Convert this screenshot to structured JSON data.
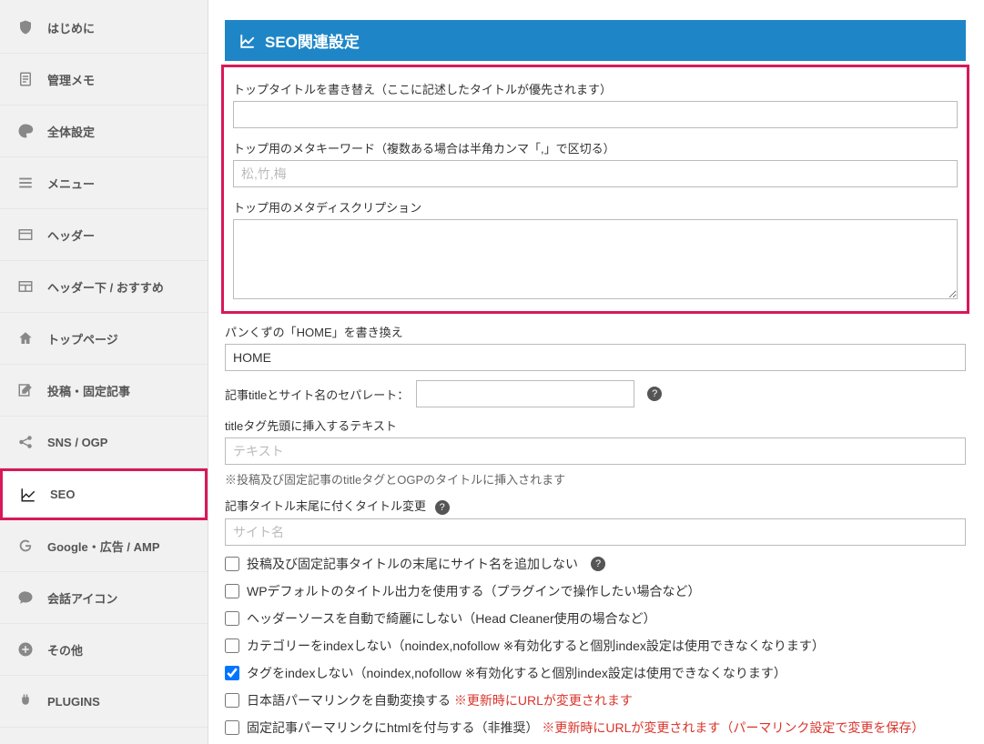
{
  "sidebar": {
    "items": [
      {
        "label": "はじめに"
      },
      {
        "label": "管理メモ"
      },
      {
        "label": "全体設定"
      },
      {
        "label": "メニュー"
      },
      {
        "label": "ヘッダー"
      },
      {
        "label": "ヘッダー下 / おすすめ"
      },
      {
        "label": "トップページ"
      },
      {
        "label": "投稿・固定記事"
      },
      {
        "label": "SNS / OGP"
      },
      {
        "label": "SEO"
      },
      {
        "label": "Google・広告 / AMP"
      },
      {
        "label": "会話アイコン"
      },
      {
        "label": "その他"
      },
      {
        "label": "PLUGINS"
      }
    ]
  },
  "panel": {
    "title": "SEO関連設定"
  },
  "fields": {
    "top_title_label": "トップタイトルを書き替え（ここに記述したタイトルが優先されます）",
    "top_title_value": "",
    "meta_keywords_label": "トップ用のメタキーワード（複数ある場合は半角カンマ「,」で区切る）",
    "meta_keywords_placeholder": "松,竹,梅",
    "meta_desc_label": "トップ用のメタディスクリプション",
    "breadcrumb_label": "パンくずの「HOME」を書き換え",
    "breadcrumb_value": "HOME",
    "separator_label": "記事titleとサイト名のセパレート：",
    "prefix_label": "titleタグ先頭に挿入するテキスト",
    "prefix_placeholder": "テキスト",
    "prefix_note": "※投稿及び固定記事のtitleタグとOGPのタイトルに挿入されます",
    "suffix_label": "記事タイトル末尾に付くタイトル変更",
    "suffix_placeholder": "サイト名"
  },
  "checks": {
    "c1": "投稿及び固定記事タイトルの末尾にサイト名を追加しない",
    "c2": "WPデフォルトのタイトル出力を使用する（プラグインで操作したい場合など）",
    "c3": "ヘッダーソースを自動で綺麗にしない（Head Cleaner使用の場合など）",
    "c4": "カテゴリーをindexしない（noindex,nofollow ※有効化すると個別index設定は使用できなくなります）",
    "c5": "タグをindexしない（noindex,nofollow ※有効化すると個別index設定は使用できなくなります）",
    "c6_a": "日本語パーマリンクを自動変換する",
    "c6_b": "※更新時にURLが変更されます",
    "c7_a": "固定記事パーマリンクにhtmlを付与する（非推奨）",
    "c7_b": "※更新時にURLが変更されます（パーマリンク設定で変更を保存）"
  }
}
